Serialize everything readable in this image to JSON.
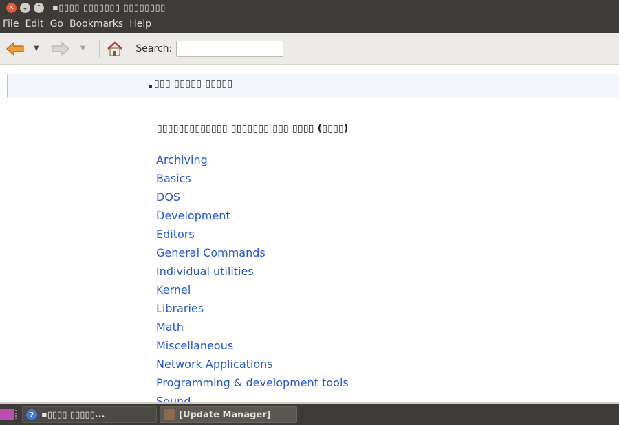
{
  "window": {
    "title": "▪▯▯▯▯ ▯▯▯▯▯▯▯ ▯▯▯▯▯▯▯▯",
    "close_glyph": "✕",
    "min_glyph": "⌄",
    "max_glyph": "⌃"
  },
  "menubar": {
    "items": [
      "File",
      "Edit",
      "Go",
      "Bookmarks",
      "Help"
    ]
  },
  "toolbar": {
    "back_icon": "back-arrow-icon",
    "forward_icon": "forward-arrow-icon",
    "home_icon": "home-icon",
    "dropdown_glyph": "▼",
    "search_label": "Search:",
    "search_value": ""
  },
  "content": {
    "breadcrumb": "▯▯▯ ▯▯▯▯▯ ▯▯▯▯▯",
    "heading": "▯▯▯▯▯▯▯▯▯▯▯▯▯ ▯▯▯▯▯▯▯ ▯▯▯ ▯▯▯▯ (▯▯▯▯)",
    "links": [
      "Archiving",
      "Basics",
      "DOS",
      "Development",
      "Editors",
      "General Commands",
      "Individual utilities",
      "Kernel",
      "Libraries",
      "Math",
      "Miscellaneous",
      "Network Applications",
      "Programming & development tools",
      "Sound"
    ]
  },
  "taskbar": {
    "tasks": [
      {
        "label": "▪▯▯▯▯ ▯▯▯▯▯...",
        "icon": "help-icon"
      },
      {
        "label": "[Update Manager]",
        "icon": "package-icon"
      }
    ],
    "help_glyph": "?"
  },
  "colors": {
    "chrome": "#3c3b37",
    "link": "#2457d6",
    "toolbar": "#edebe7"
  }
}
